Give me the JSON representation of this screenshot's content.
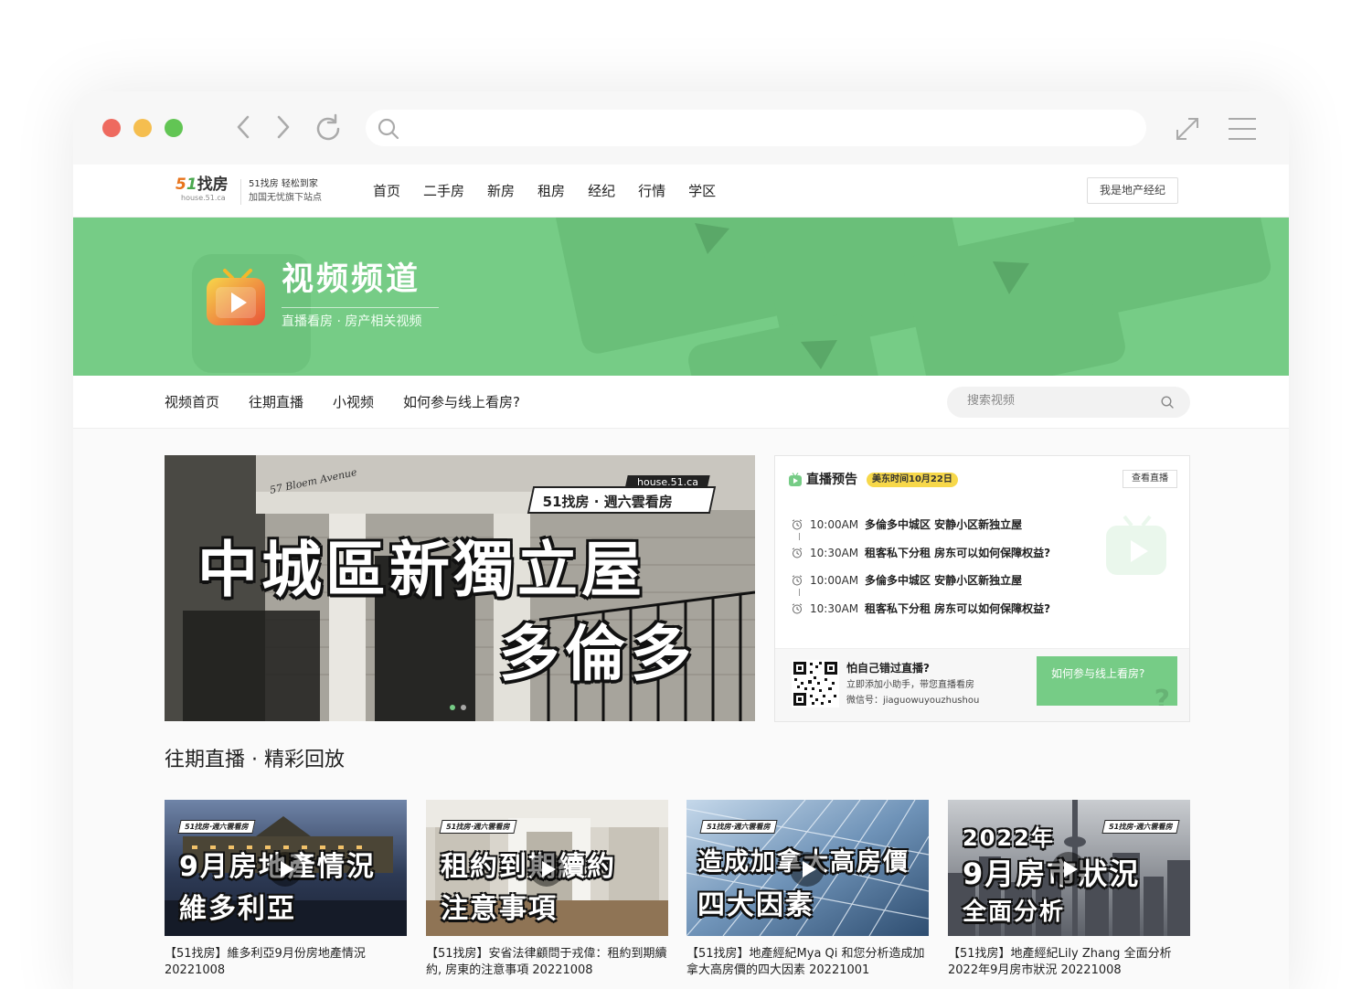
{
  "site": {
    "logo_text": "找房",
    "logo_url": "house.51.ca",
    "slogan_line1": "51找房  轻松到家",
    "slogan_line2": "加国无忧旗下站点",
    "nav": [
      "首页",
      "二手房",
      "新房",
      "租房",
      "经纪",
      "行情",
      "学区"
    ],
    "agent_button": "我是地产经纪"
  },
  "banner": {
    "title": "视频频道",
    "subtitle": "直播看房 · 房产相关视频"
  },
  "subnav": {
    "tabs": [
      "视频首页",
      "往期直播",
      "小视频",
      "如何参与线上看房?"
    ],
    "search_placeholder": "搜索视频"
  },
  "hero": {
    "url": "house.51.ca",
    "tag": "51找房 · 週六雲看房",
    "line1": "中城區新獨立屋",
    "line2": "多倫多",
    "street_sign": "57 Bloem Avenue"
  },
  "live": {
    "title": "直播预告",
    "date": "美东时间10月22日",
    "watch_button": "查看直播",
    "schedule": [
      {
        "time": "10:00AM",
        "title": "多倫多中城区 安静小区新独立屋"
      },
      {
        "time": "10:30AM",
        "title": "租客私下分租 房东可以如何保障权益?"
      },
      {
        "time": "10:00AM",
        "title": "多倫多中城区 安静小区新独立屋"
      },
      {
        "time": "10:30AM",
        "title": "租客私下分租 房东可以如何保障权益?"
      }
    ],
    "footer_question": "怕自己错过直播?",
    "footer_line1": "立即添加小助手，带您直播看房",
    "footer_line2": "微信号：jiaguowuyouzhushou",
    "join_button": "如何参与线上看房?"
  },
  "replay": {
    "section_title": "往期直播 · 精彩回放",
    "cards": [
      {
        "badge": "51找房·週六雲看房",
        "line1": "9月房地產情況",
        "line2": "維多利亞",
        "caption": "【51找房】維多利亞9月份房地產情況 20221008"
      },
      {
        "badge": "51找房·週六雲看房",
        "line1": "租約到期續約",
        "line2": "注意事項",
        "caption": "【51找房】安省法律顧問于戎偉：租約到期續約, 房東的注意事項 20221008"
      },
      {
        "badge": "51找房·週六雲看房",
        "line1": "造成加拿大高房價",
        "line2": "四大因素",
        "caption": "【51找房】地產經紀Mya Qi 和您分析造成加拿大高房價的四大因素 20221001"
      },
      {
        "badge": "51找房·週六雲看房",
        "line0": "2022年",
        "line1": "9月房市狀況",
        "line2": "全面分析",
        "caption": "【51找房】地產經紀Lily Zhang 全面分析2022年9月房市狀況 20221008"
      }
    ]
  },
  "colors": {
    "brand_green": "#76cc86",
    "accent_yellow": "#f7d84a",
    "logo_orange": "#e8741c"
  }
}
